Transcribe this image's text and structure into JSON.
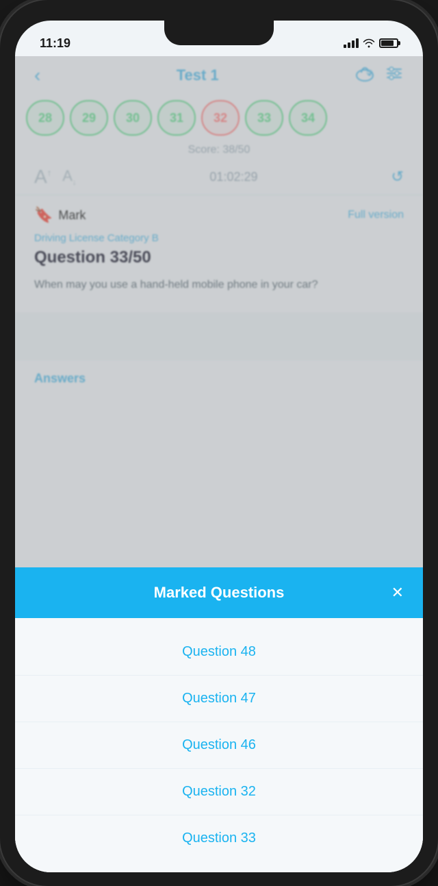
{
  "status_bar": {
    "time": "11:19",
    "signal_label": "signal",
    "wifi_label": "wifi",
    "battery_label": "battery"
  },
  "header": {
    "back_label": "‹",
    "title": "Test 1",
    "cloud_icon": "☁",
    "settings_icon": "⚙"
  },
  "question_dots": [
    {
      "number": "28",
      "state": "correct"
    },
    {
      "number": "29",
      "state": "correct"
    },
    {
      "number": "30",
      "state": "correct"
    },
    {
      "number": "31",
      "state": "correct"
    },
    {
      "number": "32",
      "state": "wrong"
    },
    {
      "number": "33",
      "state": "correct"
    },
    {
      "number": "34",
      "state": "correct"
    }
  ],
  "score": {
    "label": "Score: 38/50"
  },
  "font_controls": {
    "font_up_label": "A",
    "font_down_label": "A",
    "timer": "01:02:29",
    "refresh_label": "↺"
  },
  "question": {
    "mark_label": "Mark",
    "full_version_label": "Full version",
    "category": "Driving License Category B",
    "number": "Question 33/50",
    "text": "When may you use a hand-held mobile phone in your car?"
  },
  "answers_label": "Answers",
  "modal": {
    "title": "Marked Questions",
    "close_label": "✕",
    "items": [
      {
        "label": "Question 48"
      },
      {
        "label": "Question 47"
      },
      {
        "label": "Question 46"
      },
      {
        "label": "Question 32"
      },
      {
        "label": "Question 33"
      }
    ]
  }
}
